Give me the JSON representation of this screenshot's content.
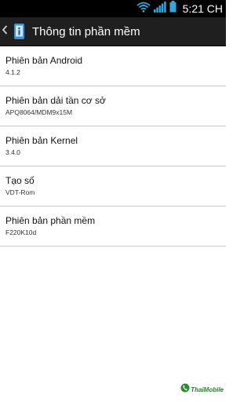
{
  "status_bar": {
    "time": "5:21 CH"
  },
  "action_bar": {
    "title": "Thông tin phần mềm"
  },
  "settings": [
    {
      "label": "Phiên bản Android",
      "value": "4.1.2"
    },
    {
      "label": "Phiên bản dải tần cơ sở",
      "value": "APQ8064/MDM9x15M"
    },
    {
      "label": "Phiên bản Kernel",
      "value": "3.4.0"
    },
    {
      "label": "Tạo số",
      "value": "VDT-Rom"
    },
    {
      "label": "Phiên bản phần mềm",
      "value": "F220K10d"
    }
  ],
  "watermark": {
    "text": "ThaiMobile"
  },
  "colors": {
    "status_bar_bg": "#000000",
    "action_bar_bg": "#1f1f1f",
    "wifi_accent": "#2fa8e0",
    "divider": "#c8c8c8"
  },
  "icons": [
    "wifi-icon",
    "signal-icon",
    "battery-icon",
    "back-arrow-icon",
    "app-info-icon",
    "phone-logo-icon"
  ]
}
